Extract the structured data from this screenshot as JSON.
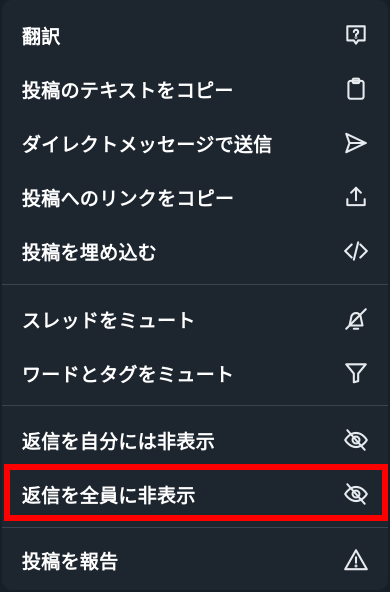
{
  "menu": {
    "items": [
      {
        "label": "翻訳",
        "icon": "translate-icon"
      },
      {
        "label": "投稿のテキストをコピー",
        "icon": "clipboard-icon"
      },
      {
        "label": "ダイレクトメッセージで送信",
        "icon": "send-icon"
      },
      {
        "label": "投稿へのリンクをコピー",
        "icon": "share-icon"
      },
      {
        "label": "投稿を埋め込む",
        "icon": "code-icon"
      },
      {
        "label": "スレッドをミュート",
        "icon": "mute-icon"
      },
      {
        "label": "ワードとタグをミュート",
        "icon": "filter-icon"
      },
      {
        "label": "返信を自分には非表示",
        "icon": "eye-slash-icon"
      },
      {
        "label": "返信を全員に非表示",
        "icon": "eye-slash-icon"
      },
      {
        "label": "投稿を報告",
        "icon": "warning-icon"
      }
    ]
  },
  "colors": {
    "background": "#1d252f",
    "text": "#ffffff",
    "divider": "#38444f",
    "highlight": "#ff0000"
  }
}
